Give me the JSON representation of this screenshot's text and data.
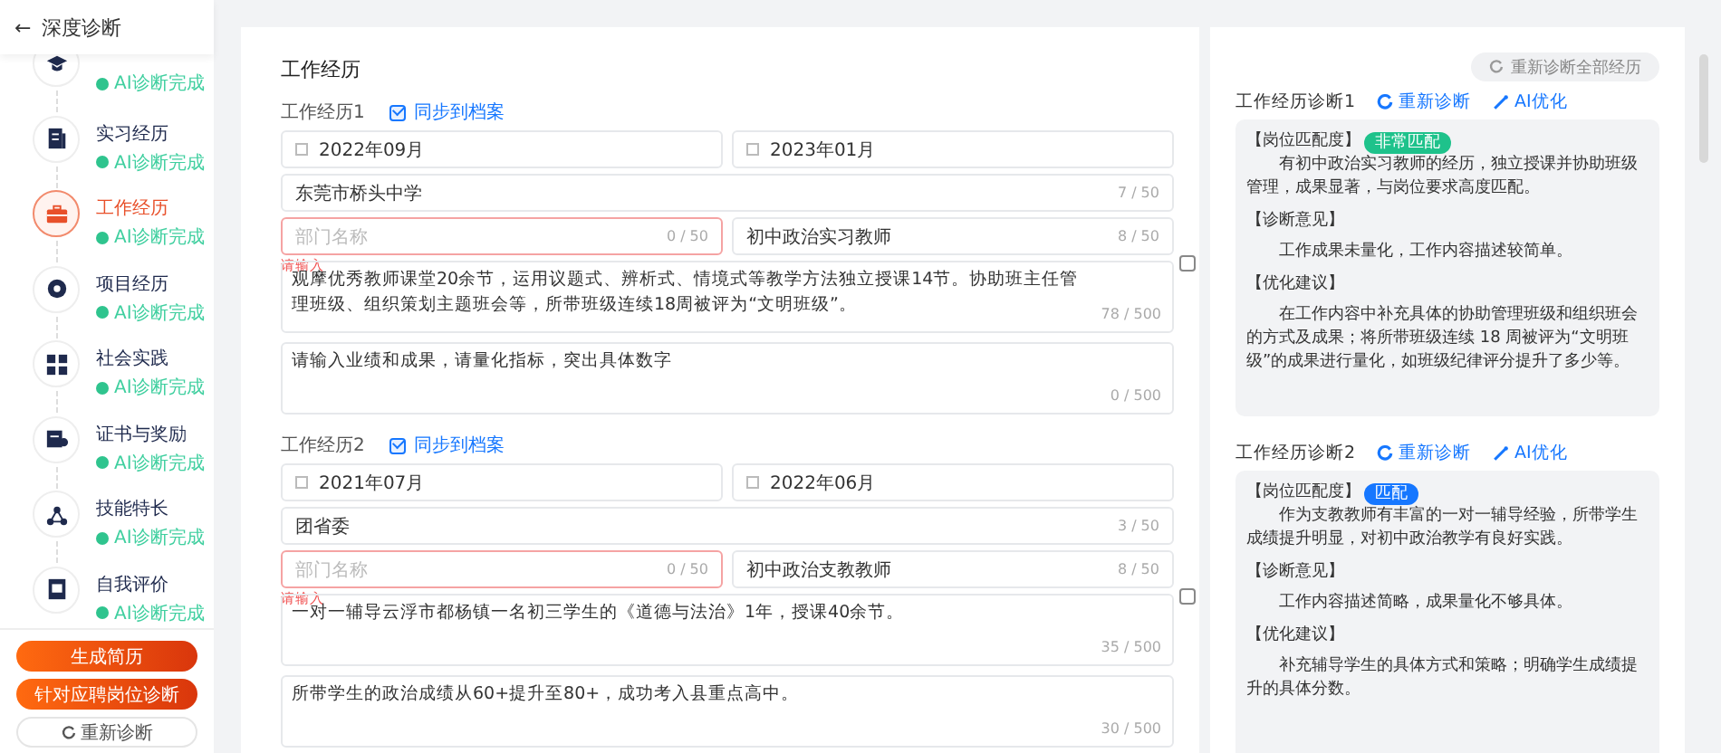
{
  "header": {
    "back": "←",
    "title": "深度诊断"
  },
  "steps": [
    {
      "kind": "cap",
      "status": "AI诊断完成",
      "selected": false
    },
    {
      "kind": "doc",
      "label": "实习经历",
      "status": "AI诊断完成",
      "selected": false
    },
    {
      "kind": "briefcase",
      "label": "工作经历",
      "status": "AI诊断完成",
      "selected": true
    },
    {
      "kind": "disc",
      "label": "项目经历",
      "status": "AI诊断完成",
      "selected": false
    },
    {
      "kind": "grid",
      "label": "社会实践",
      "status": "AI诊断完成",
      "selected": false
    },
    {
      "kind": "cert",
      "label": "证书与奖励",
      "status": "AI诊断完成",
      "selected": false
    },
    {
      "kind": "nodes",
      "label": "技能特长",
      "status": "AI诊断完成",
      "selected": false
    },
    {
      "kind": "note",
      "label": "自我评价",
      "status": "AI诊断完成",
      "selected": false
    }
  ],
  "actions": [
    {
      "kind": "primary",
      "label": "生成简历"
    },
    {
      "kind": "primary",
      "label": "针对应聘岗位诊断"
    },
    {
      "kind": "outline",
      "label": "重新诊断"
    }
  ],
  "form": {
    "title": "工作经历",
    "entries": [
      {
        "label": "工作经历1",
        "sync": {
          "label": "同步到档案",
          "checked": true
        },
        "start": "2022年09月",
        "end": "2023年01月",
        "org": {
          "value": "东莞市桥头中学",
          "count": "7 / 50"
        },
        "dept": {
          "placeholder": "部门名称",
          "count": "0 / 50",
          "error": "请输入"
        },
        "position": {
          "value": "初中政治实习教师",
          "count": "8 / 50"
        },
        "description": {
          "value": "观摩优秀教师课堂20余节，运用议题式、辨析式、情境式等教学方法独立授课14节。协助班主任管理班级、组织策划主题班会等，所带班级连续18周被评为“文明班级”。",
          "count": "78 / 500"
        },
        "achievements": {
          "placeholder": "请输入业绩和成果，请量化指标，突出具体数字",
          "count": "0 / 500"
        }
      },
      {
        "label": "工作经历2",
        "sync": {
          "label": "同步到档案",
          "checked": true
        },
        "start": "2021年07月",
        "end": "2022年06月",
        "org": {
          "value": "团省委",
          "count": "3 / 50"
        },
        "dept": {
          "placeholder": "部门名称",
          "count": "0 / 50",
          "error": "请输入"
        },
        "position": {
          "value": "初中政治支教教师",
          "count": "8 / 50"
        },
        "description": {
          "value": "一对一辅导云浮市都杨镇一名初三学生的《道德与法治》1年，授课40余节。",
          "count": "35 / 500"
        },
        "achievements": {
          "value": "所带学生的政治成绩从60+提升至80+，成功考入县重点高中。",
          "count": "30 / 500"
        }
      }
    ]
  },
  "diagnosis": {
    "rerun_all": "重新诊断全部经历",
    "items": [
      {
        "title": "工作经历诊断1",
        "rerun": "重新诊断",
        "optimize": "AI优化",
        "match_label": "【岗位匹配度】",
        "match": {
          "text": "非常匹配",
          "color": "#1ec28b"
        },
        "match_text": "有初中政治实习教师的经历，独立授课并协助班级管理，成果显著，与岗位要求高度匹配。",
        "opinion_label": "【诊断意见】",
        "opinion": "工作成果未量化，工作内容描述较简单。",
        "advice_label": "【优化建议】",
        "advice": "在工作内容中补充具体的协助管理班级和组织班会的方式及成果；将所带班级连续 18 周被评为“文明班级”的成果进行量化，如班级纪律评分提升了多少等。"
      },
      {
        "title": "工作经历诊断2",
        "rerun": "重新诊断",
        "optimize": "AI优化",
        "match_label": "【岗位匹配度】",
        "match": {
          "text": "匹配",
          "color": "#1677ff"
        },
        "match_text": "作为支教教师有丰富的一对一辅导经验，所带学生成绩提升明显，对初中政治教学有良好实践。",
        "opinion_label": "【诊断意见】",
        "opinion": "工作内容描述简略，成果量化不够具体。",
        "advice_label": "【优化建议】",
        "advice": "补充辅导学生的具体方式和策略；明确学生成绩提升的具体分数。"
      }
    ]
  }
}
